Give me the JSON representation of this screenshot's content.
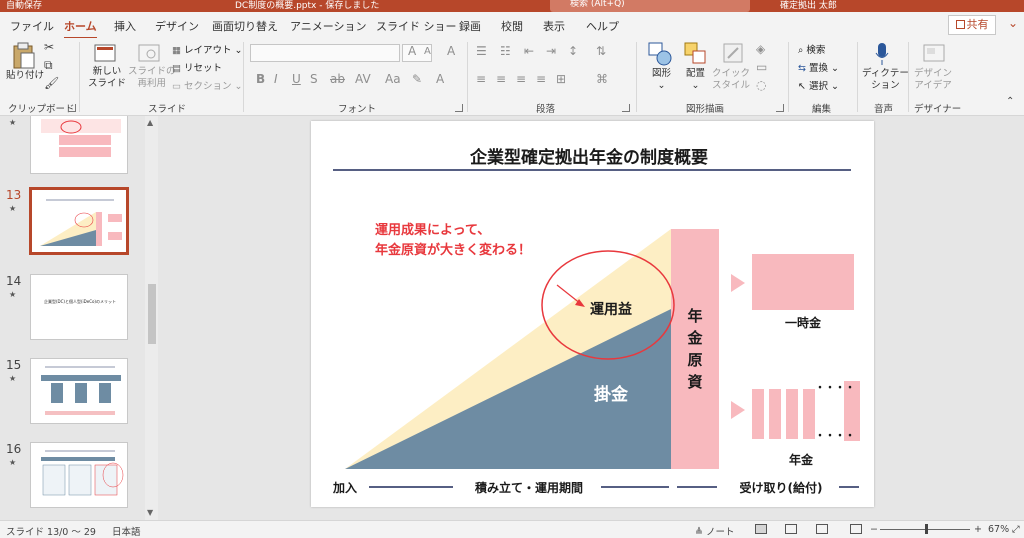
{
  "titlebar": {
    "autosave": "自動保存",
    "doc_title": "DC制度の概要.pptx - 保存しました",
    "search_placeholder": "検索 (Alt+Q)",
    "user_name": "確定拠出 太郎"
  },
  "tabs": [
    {
      "label": "ファイル"
    },
    {
      "label": "ホーム",
      "active": true
    },
    {
      "label": "挿入"
    },
    {
      "label": "デザイン"
    },
    {
      "label": "画面切り替え"
    },
    {
      "label": "アニメーション"
    },
    {
      "label": "スライド ショー"
    },
    {
      "label": "録画"
    },
    {
      "label": "校閲"
    },
    {
      "label": "表示"
    },
    {
      "label": "ヘルプ"
    }
  ],
  "share_label": "共有",
  "ribbon": {
    "clipboard": {
      "paste": "貼り付け",
      "group": "クリップボード"
    },
    "slides": {
      "new_slide": "新しい\nスライド",
      "reuse": "スライドの\n再利用",
      "layout": "レイアウト",
      "reset": "リセット",
      "section": "セクション",
      "group": "スライド"
    },
    "font": {
      "bold": "B",
      "italic": "I",
      "underline": "U",
      "strike": "S",
      "group": "フォント"
    },
    "paragraph": {
      "group": "段落"
    },
    "drawing": {
      "shapes": "図形",
      "arrange": "配置",
      "quick_styles": "クイック\nスタイル",
      "group": "図形描画"
    },
    "editing": {
      "find": "検索",
      "replace": "置換",
      "select": "選択",
      "group": "編集"
    },
    "voice": {
      "dictate": "ディクテー\nション",
      "group": "音声"
    },
    "designer": {
      "ideas": "デザイン\nアイデア",
      "group": "デザイナー"
    }
  },
  "thumbnails": [
    {
      "number": "",
      "selected": false
    },
    {
      "number": "13",
      "selected": true
    },
    {
      "number": "14",
      "selected": false,
      "text": "企業型(DC)と個人型(iDeCo)のメリット"
    },
    {
      "number": "15",
      "selected": false
    },
    {
      "number": "16",
      "selected": false
    }
  ],
  "slide": {
    "title": "企業型確定拠出年金の制度概要",
    "callout_line1": "運用成果によって、",
    "callout_line2": "年金原資が大きく変わる！",
    "returns_label": "運用益",
    "contribution_label": "掛金",
    "pension_fund_label": [
      "年",
      "金",
      "原",
      "資"
    ],
    "lump_sum_label": "一時金",
    "annuity_label": "年金",
    "dots": "・・・・",
    "timeline_start": "加入",
    "timeline_mid": "積み立て・運用期間",
    "timeline_end": "受け取り(給付)",
    "colors": {
      "returns": "#fdeec4",
      "contribution": "#6e8ca3",
      "fund": "#f8b9be",
      "callout": "#e8383d",
      "navy": "#1f2a5a"
    }
  },
  "statusbar": {
    "slide_info": "スライド 13/0 ～ 29",
    "language": "日本語",
    "notes": "ノート",
    "zoom": "67%"
  }
}
